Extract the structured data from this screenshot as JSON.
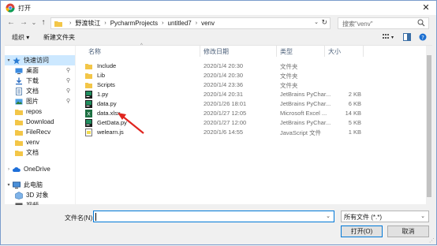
{
  "window": {
    "title": "打开",
    "close_glyph": "✕"
  },
  "nav": {
    "back": "←",
    "forward": "→",
    "up_dropdown": "⌄",
    "up": "↑",
    "breadcrumbs": [
      "野渡犊江",
      "PycharmProjects",
      "untitled7",
      "venv"
    ],
    "search_placeholder": "搜索\"venv\""
  },
  "toolbar": {
    "organize": "组织 ▾",
    "new_folder": "新建文件夹"
  },
  "sidebar": {
    "items": [
      {
        "label": "快速访问",
        "icon": "star-icon",
        "pinned": false,
        "expand": "▾"
      },
      {
        "label": "桌面",
        "icon": "desktop-icon",
        "pinned": true
      },
      {
        "label": "下载",
        "icon": "download-icon",
        "pinned": true
      },
      {
        "label": "文档",
        "icon": "document-icon",
        "pinned": true
      },
      {
        "label": "图片",
        "icon": "picture-icon",
        "pinned": true
      },
      {
        "label": "repos",
        "icon": "folder-icon",
        "pinned": false
      },
      {
        "label": "Download",
        "icon": "folder-icon",
        "pinned": false
      },
      {
        "label": "FileRecv",
        "icon": "folder-icon",
        "pinned": false
      },
      {
        "label": "venv",
        "icon": "folder-icon",
        "pinned": false
      },
      {
        "label": "文档",
        "icon": "folder-icon",
        "pinned": false
      },
      {
        "label": "OneDrive",
        "icon": "cloud-icon",
        "pinned": false,
        "expand": "›"
      },
      {
        "label": "此电脑",
        "icon": "computer-icon",
        "pinned": false,
        "expand": "▾"
      },
      {
        "label": "3D 对象",
        "icon": "3d-objects-icon",
        "pinned": false
      },
      {
        "label": "视频",
        "icon": "video-icon",
        "pinned": false
      }
    ],
    "pin_glyph": "📌"
  },
  "filelist": {
    "columns": {
      "name": "名称",
      "date": "修改日期",
      "type": "类型",
      "size": "大小"
    },
    "rows": [
      {
        "name": "Include",
        "date": "2020/1/4 20:30",
        "type": "文件夹",
        "size": "",
        "icon": "folder-icon"
      },
      {
        "name": "Lib",
        "date": "2020/1/4 20:30",
        "type": "文件夹",
        "size": "",
        "icon": "folder-icon"
      },
      {
        "name": "Scripts",
        "date": "2020/1/4 23:36",
        "type": "文件夹",
        "size": "",
        "icon": "folder-icon"
      },
      {
        "name": "1.py",
        "date": "2020/1/4 20:31",
        "type": "JetBrains PyChar...",
        "size": "2 KB",
        "icon": "pycharm-file-icon"
      },
      {
        "name": "data.py",
        "date": "2020/1/26 18:01",
        "type": "JetBrains PyChar...",
        "size": "6 KB",
        "icon": "pycharm-file-icon"
      },
      {
        "name": "data.xlsx",
        "date": "2020/1/27 12:05",
        "type": "Microsoft Excel ...",
        "size": "14 KB",
        "icon": "excel-file-icon"
      },
      {
        "name": "GetData.py",
        "date": "2020/1/27 12:00",
        "type": "JetBrains PyChar...",
        "size": "5 KB",
        "icon": "pycharm-file-icon"
      },
      {
        "name": "welearn.js",
        "date": "2020/1/6 14:55",
        "type": "JavaScript 文件",
        "size": "1 KB",
        "icon": "js-file-icon"
      }
    ]
  },
  "bottom": {
    "filename_label": "文件名(N):",
    "filename_value": "",
    "filetype_value": "所有文件 (*.*)",
    "open_button": "打开(O)",
    "cancel_button": "取消"
  },
  "colors": {
    "accent": "#0078d7",
    "folder": "#f3c648",
    "selection": "#cce8ff",
    "arrow": "#e0251f"
  }
}
